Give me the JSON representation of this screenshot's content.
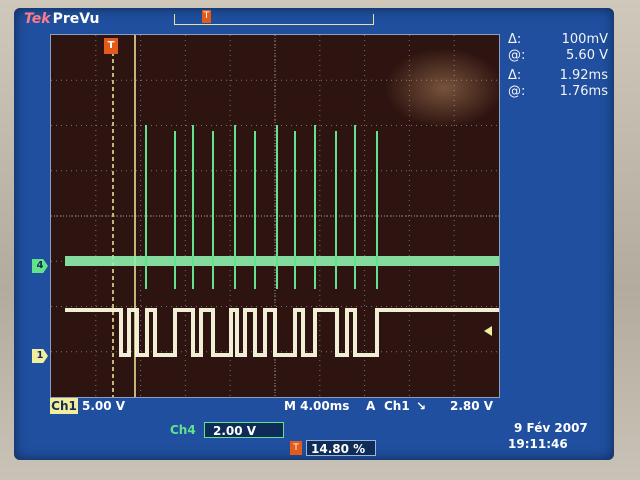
{
  "header": {
    "brand": "Tek",
    "mode": "PreVu"
  },
  "cursor_readouts": [
    {
      "symbol": "Δ:",
      "value": "100mV"
    },
    {
      "symbol": "@:",
      "value": "5.60 V"
    },
    {
      "symbol": "Δ:",
      "value": "1.92ms"
    },
    {
      "symbol": "@:",
      "value": "1.76ms"
    }
  ],
  "channels": {
    "ch1": {
      "label": "Ch1",
      "scale": "5.00 V",
      "marker": "1",
      "color": "#f0ef9d"
    },
    "ch4": {
      "label": "Ch4",
      "scale": "2.00 V",
      "marker": "4",
      "color": "#63e28e"
    }
  },
  "timebase": {
    "label": "M 4.00ms"
  },
  "trigger": {
    "mode": "A",
    "source": "Ch1",
    "slope": "↘",
    "level": "2.80 V",
    "position": "14.80 %",
    "marker": "T"
  },
  "datetime": {
    "date": "9 Fév 2007",
    "time": "19:11:46"
  },
  "colors": {
    "screen_bg": "#1f4f9e",
    "grid_bg": "#2e1410",
    "accent_trigger": "#e35a1b"
  }
}
